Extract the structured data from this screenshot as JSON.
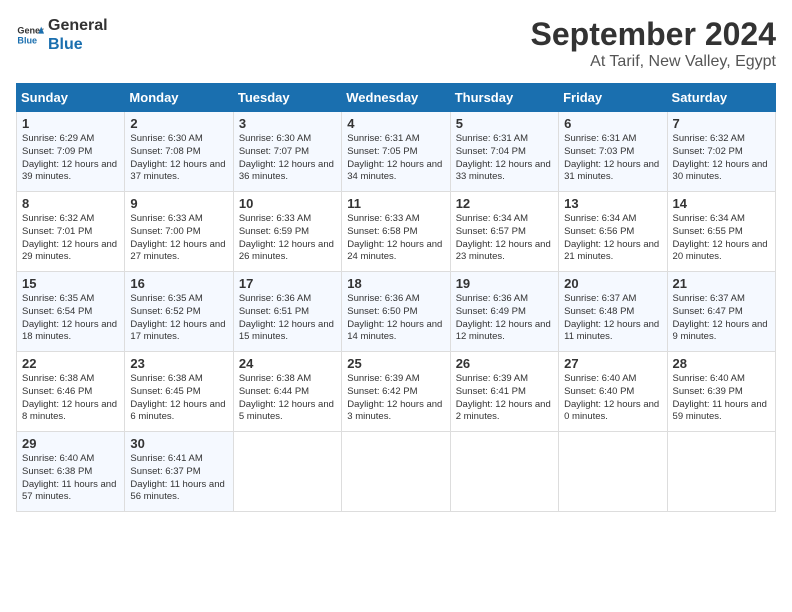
{
  "logo": {
    "line1": "General",
    "line2": "Blue"
  },
  "title": "September 2024",
  "subtitle": "At Tarif, New Valley, Egypt",
  "days_of_week": [
    "Sunday",
    "Monday",
    "Tuesday",
    "Wednesday",
    "Thursday",
    "Friday",
    "Saturday"
  ],
  "weeks": [
    [
      {
        "day": 1,
        "rise": "6:29 AM",
        "set": "7:09 PM",
        "daylight": "12 hours and 39 minutes."
      },
      {
        "day": 2,
        "rise": "6:30 AM",
        "set": "7:08 PM",
        "daylight": "12 hours and 37 minutes."
      },
      {
        "day": 3,
        "rise": "6:30 AM",
        "set": "7:07 PM",
        "daylight": "12 hours and 36 minutes."
      },
      {
        "day": 4,
        "rise": "6:31 AM",
        "set": "7:05 PM",
        "daylight": "12 hours and 34 minutes."
      },
      {
        "day": 5,
        "rise": "6:31 AM",
        "set": "7:04 PM",
        "daylight": "12 hours and 33 minutes."
      },
      {
        "day": 6,
        "rise": "6:31 AM",
        "set": "7:03 PM",
        "daylight": "12 hours and 31 minutes."
      },
      {
        "day": 7,
        "rise": "6:32 AM",
        "set": "7:02 PM",
        "daylight": "12 hours and 30 minutes."
      }
    ],
    [
      {
        "day": 8,
        "rise": "6:32 AM",
        "set": "7:01 PM",
        "daylight": "12 hours and 29 minutes."
      },
      {
        "day": 9,
        "rise": "6:33 AM",
        "set": "7:00 PM",
        "daylight": "12 hours and 27 minutes."
      },
      {
        "day": 10,
        "rise": "6:33 AM",
        "set": "6:59 PM",
        "daylight": "12 hours and 26 minutes."
      },
      {
        "day": 11,
        "rise": "6:33 AM",
        "set": "6:58 PM",
        "daylight": "12 hours and 24 minutes."
      },
      {
        "day": 12,
        "rise": "6:34 AM",
        "set": "6:57 PM",
        "daylight": "12 hours and 23 minutes."
      },
      {
        "day": 13,
        "rise": "6:34 AM",
        "set": "6:56 PM",
        "daylight": "12 hours and 21 minutes."
      },
      {
        "day": 14,
        "rise": "6:34 AM",
        "set": "6:55 PM",
        "daylight": "12 hours and 20 minutes."
      }
    ],
    [
      {
        "day": 15,
        "rise": "6:35 AM",
        "set": "6:54 PM",
        "daylight": "12 hours and 18 minutes."
      },
      {
        "day": 16,
        "rise": "6:35 AM",
        "set": "6:52 PM",
        "daylight": "12 hours and 17 minutes."
      },
      {
        "day": 17,
        "rise": "6:36 AM",
        "set": "6:51 PM",
        "daylight": "12 hours and 15 minutes."
      },
      {
        "day": 18,
        "rise": "6:36 AM",
        "set": "6:50 PM",
        "daylight": "12 hours and 14 minutes."
      },
      {
        "day": 19,
        "rise": "6:36 AM",
        "set": "6:49 PM",
        "daylight": "12 hours and 12 minutes."
      },
      {
        "day": 20,
        "rise": "6:37 AM",
        "set": "6:48 PM",
        "daylight": "12 hours and 11 minutes."
      },
      {
        "day": 21,
        "rise": "6:37 AM",
        "set": "6:47 PM",
        "daylight": "12 hours and 9 minutes."
      }
    ],
    [
      {
        "day": 22,
        "rise": "6:38 AM",
        "set": "6:46 PM",
        "daylight": "12 hours and 8 minutes."
      },
      {
        "day": 23,
        "rise": "6:38 AM",
        "set": "6:45 PM",
        "daylight": "12 hours and 6 minutes."
      },
      {
        "day": 24,
        "rise": "6:38 AM",
        "set": "6:44 PM",
        "daylight": "12 hours and 5 minutes."
      },
      {
        "day": 25,
        "rise": "6:39 AM",
        "set": "6:42 PM",
        "daylight": "12 hours and 3 minutes."
      },
      {
        "day": 26,
        "rise": "6:39 AM",
        "set": "6:41 PM",
        "daylight": "12 hours and 2 minutes."
      },
      {
        "day": 27,
        "rise": "6:40 AM",
        "set": "6:40 PM",
        "daylight": "12 hours and 0 minutes."
      },
      {
        "day": 28,
        "rise": "6:40 AM",
        "set": "6:39 PM",
        "daylight": "11 hours and 59 minutes."
      }
    ],
    [
      {
        "day": 29,
        "rise": "6:40 AM",
        "set": "6:38 PM",
        "daylight": "11 hours and 57 minutes."
      },
      {
        "day": 30,
        "rise": "6:41 AM",
        "set": "6:37 PM",
        "daylight": "11 hours and 56 minutes."
      },
      null,
      null,
      null,
      null,
      null
    ]
  ]
}
